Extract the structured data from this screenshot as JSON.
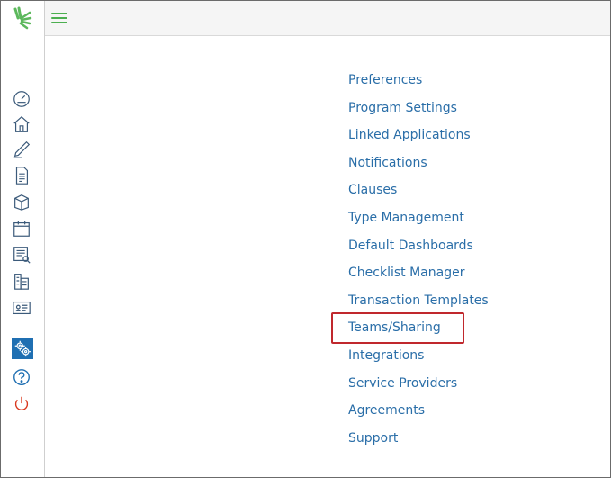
{
  "app": {
    "brand_color": "#5cb85c",
    "link_color": "#2a6ea8",
    "highlight_color": "#c0282d"
  },
  "sidebar": {
    "icons": [
      {
        "name": "dashboard-gauge-icon"
      },
      {
        "name": "home-icon"
      },
      {
        "name": "pen-icon"
      },
      {
        "name": "document-icon"
      },
      {
        "name": "box-icon"
      },
      {
        "name": "calendar-icon"
      },
      {
        "name": "report-search-icon"
      },
      {
        "name": "building-icon"
      },
      {
        "name": "contact-card-icon"
      },
      {
        "name": "settings-gears-icon",
        "active": true
      },
      {
        "name": "help-icon"
      },
      {
        "name": "power-icon"
      }
    ]
  },
  "menu": {
    "items": [
      "Preferences",
      "Program Settings",
      "Linked Applications",
      "Notifications",
      "Clauses",
      "Type Management",
      "Default Dashboards",
      "Checklist Manager",
      "Transaction Templates",
      "Teams/Sharing",
      "Integrations",
      "Service Providers",
      "Agreements",
      "Support"
    ],
    "highlighted": "Teams/Sharing"
  }
}
